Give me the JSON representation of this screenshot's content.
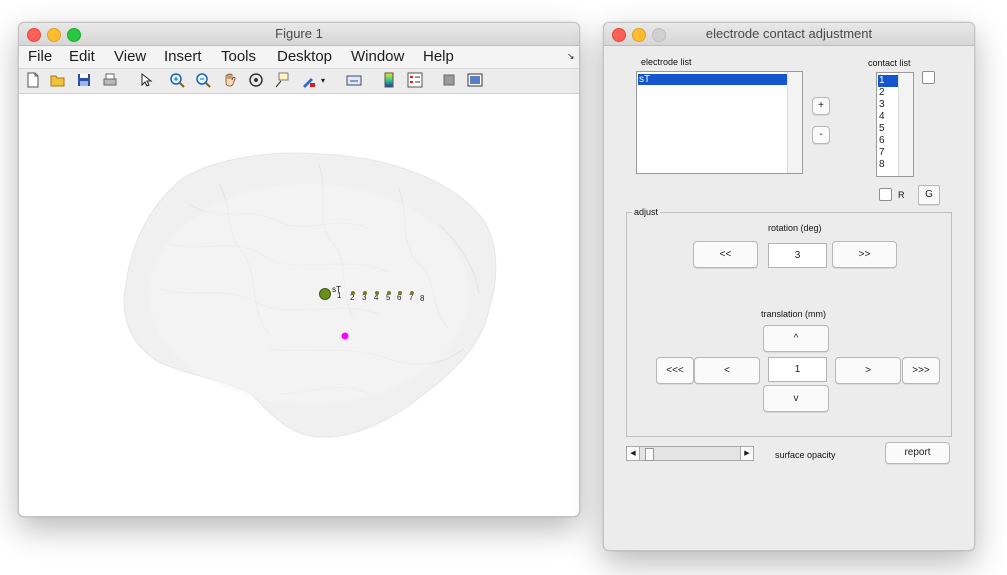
{
  "figure": {
    "title": "Figure 1",
    "menu": [
      "File",
      "Edit",
      "View",
      "Insert",
      "Tools",
      "Desktop",
      "Window",
      "Help"
    ],
    "contact_labels": [
      "1",
      "2",
      "3",
      "4",
      "5",
      "6",
      "7",
      "8"
    ],
    "electrode_marker_text": "sT",
    "colors": {
      "contact_marker": "#6a8f1c",
      "target_marker": "#ff00ff",
      "brain": "#f0f0f0"
    }
  },
  "adjust_window": {
    "title": "electrode contact adjustment",
    "electrode_list": {
      "label": "electrode list",
      "items": [
        "sT"
      ],
      "selected": "sT"
    },
    "add_label": "+",
    "remove_label": "-",
    "contact_list": {
      "label": "contact list",
      "items": [
        "1",
        "2",
        "3",
        "4",
        "5",
        "6",
        "7",
        "8"
      ],
      "selected": "1"
    },
    "r_label": "R",
    "g_label": "G",
    "adjust_panel_label": "adjust",
    "rotation": {
      "label": "rotation (deg)",
      "value": "3",
      "left_label": "<<",
      "right_label": ">>"
    },
    "translation": {
      "label": "translation (mm)",
      "value": "1",
      "up_label": "^",
      "down_label": "v",
      "left_label": "<",
      "right_label": ">",
      "far_left_label": "<<<",
      "far_right_label": ">>>"
    },
    "opacity": {
      "label": "surface opacity",
      "value_fraction": 0.05
    },
    "report_label": "report"
  }
}
